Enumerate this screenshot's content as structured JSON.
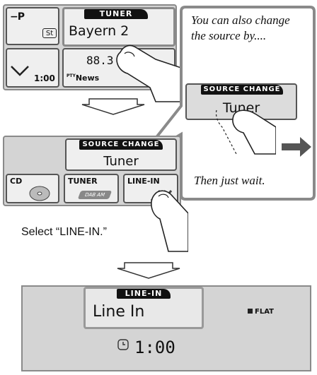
{
  "step1": {
    "preset_label": "P",
    "stereo_label": "St",
    "tuner_badge": "TUNER",
    "station_name": "Bayern 2",
    "frequency": "88.3",
    "clock": "1:00",
    "pty_prefix": "PTY",
    "pty_value": "News"
  },
  "callout": {
    "intro_text": "You can also change the source by....",
    "source_change_badge": "SOURCE CHANGE",
    "source_value": "Tuner",
    "footer_text": "Then just wait."
  },
  "step2": {
    "source_change_badge": "SOURCE CHANGE",
    "source_value": "Tuner",
    "buttons": [
      {
        "label": "CD"
      },
      {
        "label": "TUNER",
        "sublabel": "DAB AM"
      },
      {
        "label": "LINE-IN"
      }
    ]
  },
  "instruction": "Select “LINE-IN.”",
  "step3": {
    "badge": "LINE-IN",
    "source_name": "Line In",
    "eq_label": "FLAT",
    "clock": "1:00"
  },
  "colors": {
    "screen_bg": "#d4d4d4",
    "frame": "#8a8a8a",
    "badge_bg": "#111111"
  }
}
